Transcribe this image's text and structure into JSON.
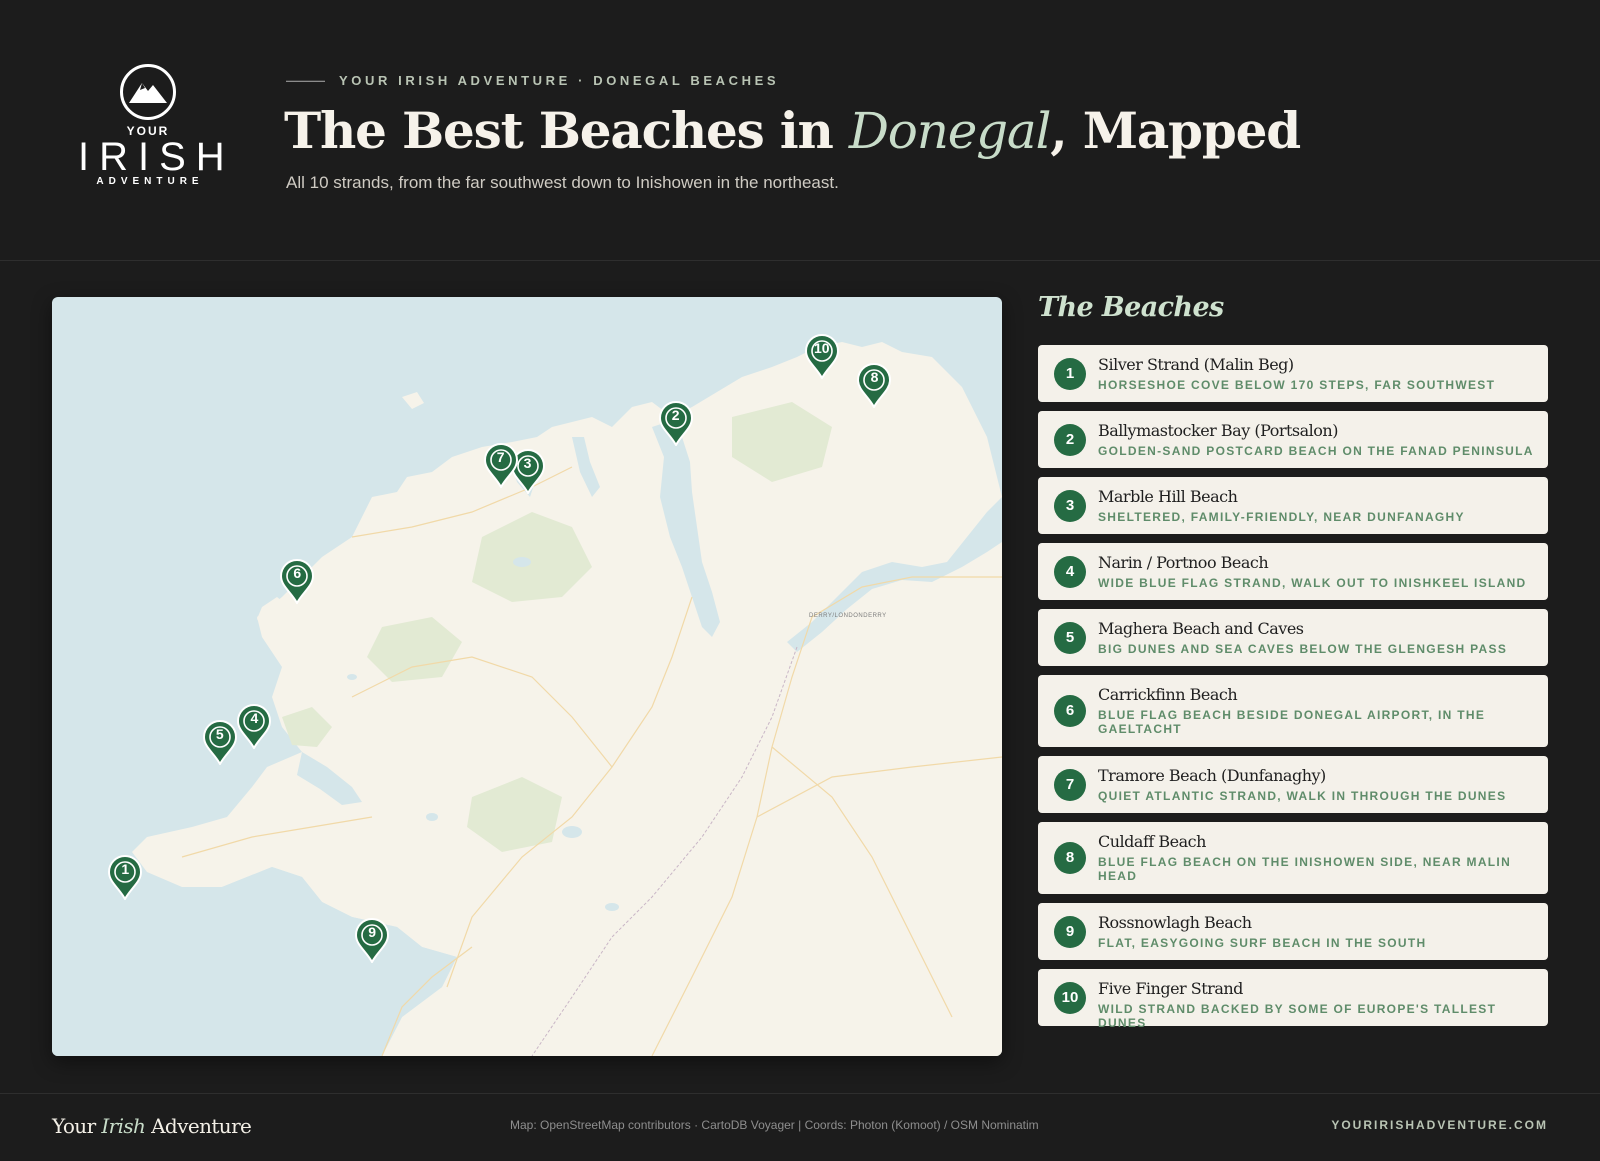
{
  "header": {
    "logo": {
      "line1": "YOUR",
      "line2": "IRISH",
      "line3": "ADVENTURE"
    },
    "eyebrow_dash": "———",
    "eyebrow": "YOUR IRISH ADVENTURE · DONEGAL BEACHES",
    "title_pre": "The Best Beaches in ",
    "title_accent": "Donegal",
    "title_post": ", Mapped",
    "subtitle": "All 10 strands, from the far southwest down to Inishowen in the northeast."
  },
  "map": {
    "pin_color": "#256b43",
    "labels": [
      "DERRY/LONDONDERRY"
    ],
    "pins": [
      {
        "num": "1",
        "lat": 54.637,
        "lon": -8.698
      },
      {
        "num": "2",
        "lat": 55.242,
        "lon": -7.632
      },
      {
        "num": "3",
        "lat": 55.178,
        "lon": -7.919
      },
      {
        "num": "4",
        "lat": 54.838,
        "lon": -8.448
      },
      {
        "num": "5",
        "lat": 54.817,
        "lon": -8.515
      },
      {
        "num": "6",
        "lat": 55.032,
        "lon": -8.365
      },
      {
        "num": "7",
        "lat": 55.186,
        "lon": -7.971
      },
      {
        "num": "8",
        "lat": 55.292,
        "lon": -7.247
      },
      {
        "num": "9",
        "lat": 54.554,
        "lon": -8.22
      },
      {
        "num": "10",
        "lat": 55.331,
        "lon": -7.349
      }
    ]
  },
  "list": {
    "title": "The Beaches",
    "items": [
      {
        "num": "1",
        "name": "Silver Strand (Malin Beg)",
        "desc": "HORSESHOE COVE BELOW 170 STEPS, FAR SOUTHWEST"
      },
      {
        "num": "2",
        "name": "Ballymastocker Bay (Portsalon)",
        "desc": "GOLDEN-SAND POSTCARD BEACH ON THE FANAD PENINSULA"
      },
      {
        "num": "3",
        "name": "Marble Hill Beach",
        "desc": "SHELTERED, FAMILY-FRIENDLY, NEAR DUNFANAGHY"
      },
      {
        "num": "4",
        "name": "Narin / Portnoo Beach",
        "desc": "WIDE BLUE FLAG STRAND, WALK OUT TO INISHKEEL ISLAND"
      },
      {
        "num": "5",
        "name": "Maghera Beach and Caves",
        "desc": "BIG DUNES AND SEA CAVES BELOW THE GLENGESH PASS"
      },
      {
        "num": "6",
        "name": "Carrickfinn Beach",
        "desc": "BLUE FLAG BEACH BESIDE DONEGAL AIRPORT, IN THE GAELTACHT"
      },
      {
        "num": "7",
        "name": "Tramore Beach (Dunfanaghy)",
        "desc": "QUIET ATLANTIC STRAND, WALK IN THROUGH THE DUNES"
      },
      {
        "num": "8",
        "name": "Culdaff Beach",
        "desc": "BLUE FLAG BEACH ON THE INISHOWEN SIDE, NEAR MALIN HEAD"
      },
      {
        "num": "9",
        "name": "Rossnowlagh Beach",
        "desc": "FLAT, EASYGOING SURF BEACH IN THE SOUTH"
      },
      {
        "num": "10",
        "name": "Five Finger Strand",
        "desc": "WILD STRAND BACKED BY SOME OF EUROPE'S TALLEST DUNES"
      }
    ]
  },
  "footer": {
    "brand_pre": "Your ",
    "brand_accent": "Irish",
    "brand_post": " Adventure",
    "credits": "Map: OpenStreetMap contributors · CartoDB Voyager | Coords: Photon (Komoot) / OSM Nominatim",
    "site": "YOURIRISHADVENTURE.COM"
  },
  "colors": {
    "background": "#1c1c1c",
    "accent": "#c8dcc9",
    "pin": "#256b43",
    "card": "#f4f1ea"
  }
}
